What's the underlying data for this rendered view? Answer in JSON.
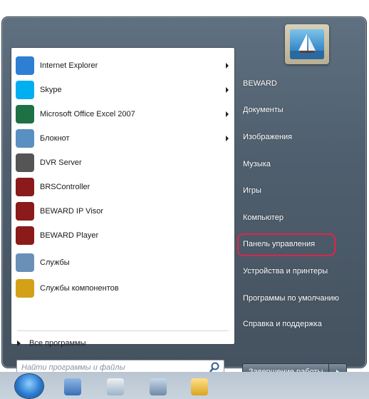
{
  "programs": [
    {
      "label": "Internet Explorer",
      "icon": "internet-explorer-icon",
      "has_submenu": true,
      "color": "#2d7fd3"
    },
    {
      "label": "Skype",
      "icon": "skype-icon",
      "has_submenu": true,
      "color": "#00aff0"
    },
    {
      "label": "Microsoft Office Excel 2007",
      "icon": "excel-icon",
      "has_submenu": true,
      "color": "#1e7145"
    },
    {
      "label": "Блокнот",
      "icon": "notepad-icon",
      "has_submenu": true,
      "color": "#5a8fc2"
    },
    {
      "label": "DVR Server",
      "icon": "dvr-server-icon",
      "has_submenu": false,
      "color": "#555555"
    },
    {
      "label": "BRSController",
      "icon": "beward-logo-icon",
      "has_submenu": false,
      "color": "#8b1a1a"
    },
    {
      "label": "BEWARD IP Visor",
      "icon": "beward-logo-icon",
      "has_submenu": false,
      "color": "#8b1a1a"
    },
    {
      "label": "BEWARD Player",
      "icon": "beward-logo-icon",
      "has_submenu": false,
      "color": "#8b1a1a"
    },
    {
      "label": "Службы",
      "icon": "services-gear-icon",
      "has_submenu": false,
      "color": "#6a90b8"
    },
    {
      "label": "Службы компонентов",
      "icon": "component-services-icon",
      "has_submenu": false,
      "color": "#d4a017"
    }
  ],
  "all_programs_label": "Все программы",
  "search": {
    "placeholder": "Найти программы и файлы"
  },
  "right_menu": [
    "BEWARD",
    "Документы",
    "Изображения",
    "Музыка",
    "Игры",
    "Компьютер",
    "Панель управления",
    "Устройства и принтеры",
    "Программы по умолчанию",
    "Справка и поддержка"
  ],
  "shutdown_label": "Завершение работы",
  "highlight_color": "#e0244a"
}
